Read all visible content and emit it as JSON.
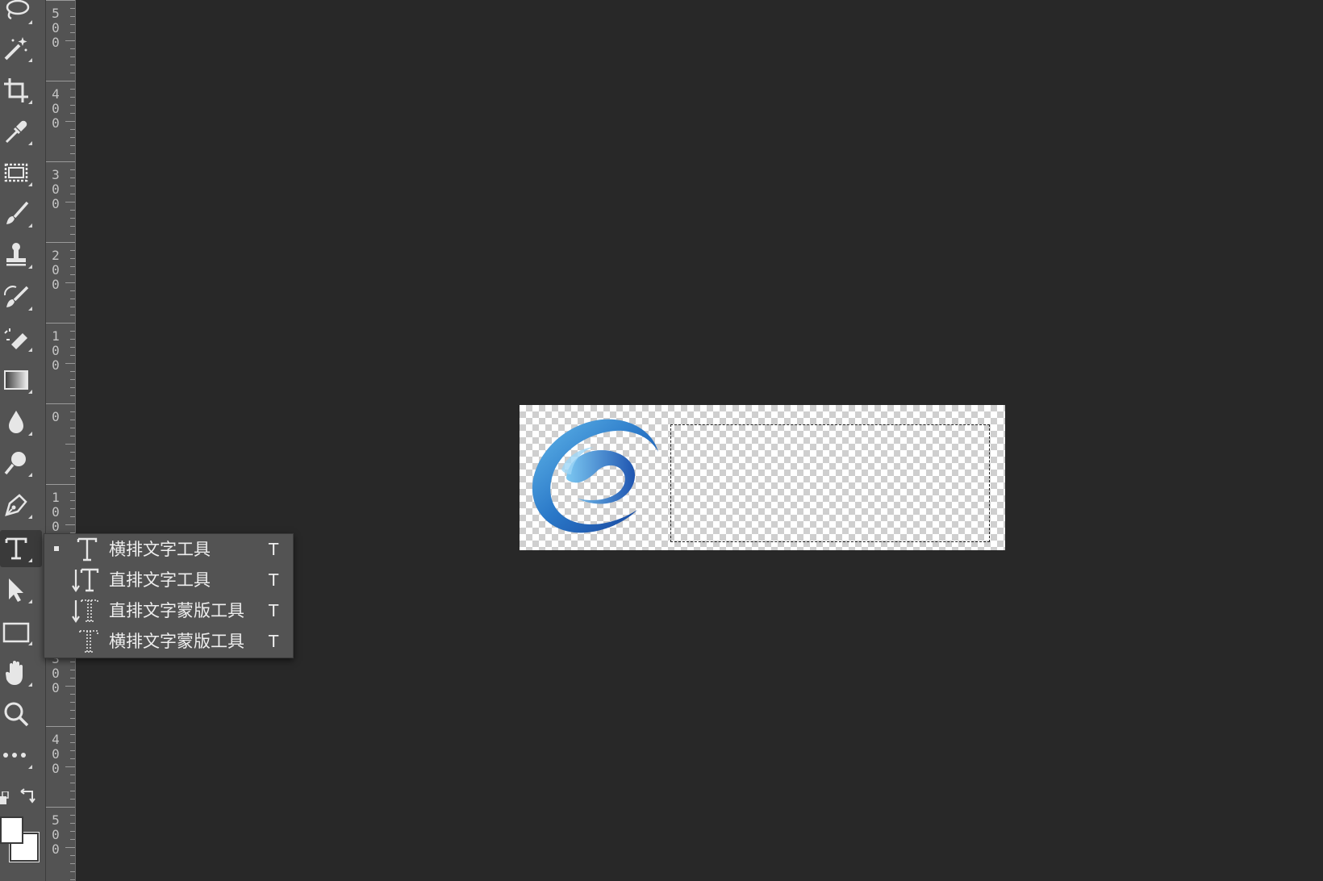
{
  "ruler": {
    "labels": [
      {
        "d1": "5",
        "d2": "0",
        "d3": "0"
      },
      {
        "d1": "4",
        "d2": "0",
        "d3": "0"
      },
      {
        "d1": "3",
        "d2": "0",
        "d3": "0"
      },
      {
        "d1": "2",
        "d2": "0",
        "d3": "0"
      },
      {
        "d1": "1",
        "d2": "0",
        "d3": "0"
      },
      {
        "d1": "0",
        "d2": "",
        "d3": ""
      },
      {
        "d1": "1",
        "d2": "0",
        "d3": "0"
      },
      {
        "d1": "",
        "d2": "",
        "d3": ""
      },
      {
        "d1": "3",
        "d2": "0",
        "d3": "0"
      },
      {
        "d1": "4",
        "d2": "0",
        "d3": "0"
      },
      {
        "d1": "5",
        "d2": "0",
        "d3": "0"
      }
    ]
  },
  "toolbar": {
    "tools": [
      "lasso-icon",
      "magic-wand-icon",
      "crop-icon",
      "eyedropper-icon",
      "frame-icon",
      "brush-icon",
      "stamp-icon",
      "history-brush-icon",
      "eraser-icon",
      "gradient-icon",
      "blur-icon",
      "dodge-icon",
      "pen-icon",
      "type-icon",
      "path-select-icon",
      "rectangle-icon",
      "hand-icon",
      "zoom-icon",
      "more-icon"
    ],
    "active_tool": "type-icon"
  },
  "flyout": {
    "items": [
      {
        "label": "横排文字工具",
        "shortcut": "T",
        "icon": "horizontal-type-icon",
        "selected": true
      },
      {
        "label": "直排文字工具",
        "shortcut": "T",
        "icon": "vertical-type-icon",
        "selected": false
      },
      {
        "label": "直排文字蒙版工具",
        "shortcut": "T",
        "icon": "vertical-type-mask-icon",
        "selected": false
      },
      {
        "label": "横排文字蒙版工具",
        "shortcut": "T",
        "icon": "horizontal-type-mask-icon",
        "selected": false
      }
    ]
  },
  "colors": {
    "workspace": "#282828",
    "panel": "#535353",
    "logo_blue_light": "#4fa8e0",
    "logo_blue_dark": "#1a4ea8"
  }
}
